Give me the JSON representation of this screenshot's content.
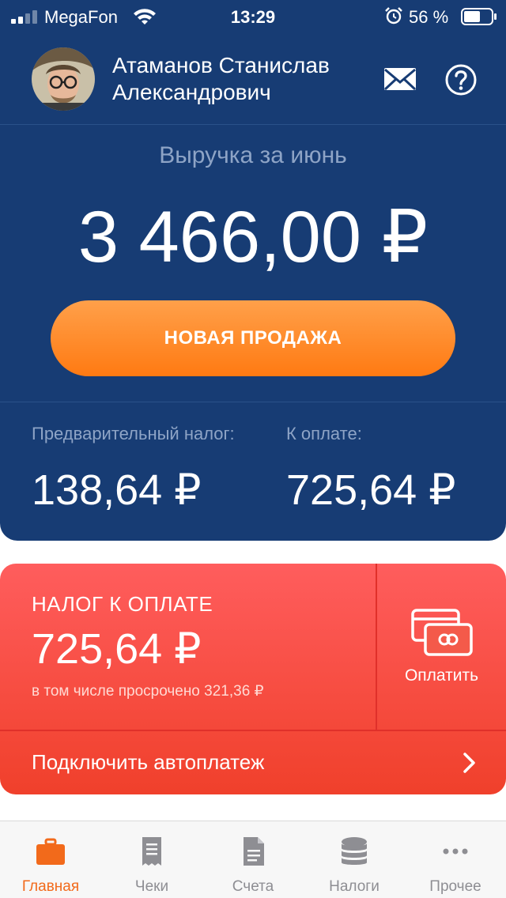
{
  "status_bar": {
    "carrier": "MegaFon",
    "time": "13:29",
    "battery_percent": "56 %",
    "icons": [
      "signal-icon",
      "wifi-icon",
      "alarm-icon",
      "battery-icon"
    ]
  },
  "header": {
    "user_name_line1": "Атаманов Станислав",
    "user_name_line2": "Александрович",
    "icons": [
      "avatar",
      "mail-icon",
      "help-icon"
    ]
  },
  "revenue": {
    "label": "Выручка за июнь",
    "amount": "3 466,00 ₽"
  },
  "new_sale_button": "НОВАЯ ПРОДАЖА",
  "summary": {
    "preliminary_tax_label": "Предварительный налог:",
    "preliminary_tax_value": "138,64 ₽",
    "to_pay_label": "К оплате:",
    "to_pay_value": "725,64 ₽"
  },
  "tax_card": {
    "title": "НАЛОГ К ОПЛАТЕ",
    "amount": "725,64 ₽",
    "overdue": "в том числе просрочено 321,36 ₽",
    "pay_label": "Оплатить",
    "autopay_label": "Подключить автоплатеж",
    "icons": [
      "cards-icon",
      "chevron-right-icon"
    ]
  },
  "tabbar": {
    "active": "Главная",
    "tabs": [
      {
        "label": "Главная",
        "icon": "briefcase-icon"
      },
      {
        "label": "Чеки",
        "icon": "receipt-icon"
      },
      {
        "label": "Счета",
        "icon": "document-icon"
      },
      {
        "label": "Налоги",
        "icon": "coins-icon"
      },
      {
        "label": "Прочее",
        "icon": "more-icon"
      }
    ]
  },
  "colors": {
    "header_blue": "#173c74",
    "accent_orange": "#ff7a12",
    "card_red": "#f0402b",
    "muted_label": "#8ea4c6"
  }
}
